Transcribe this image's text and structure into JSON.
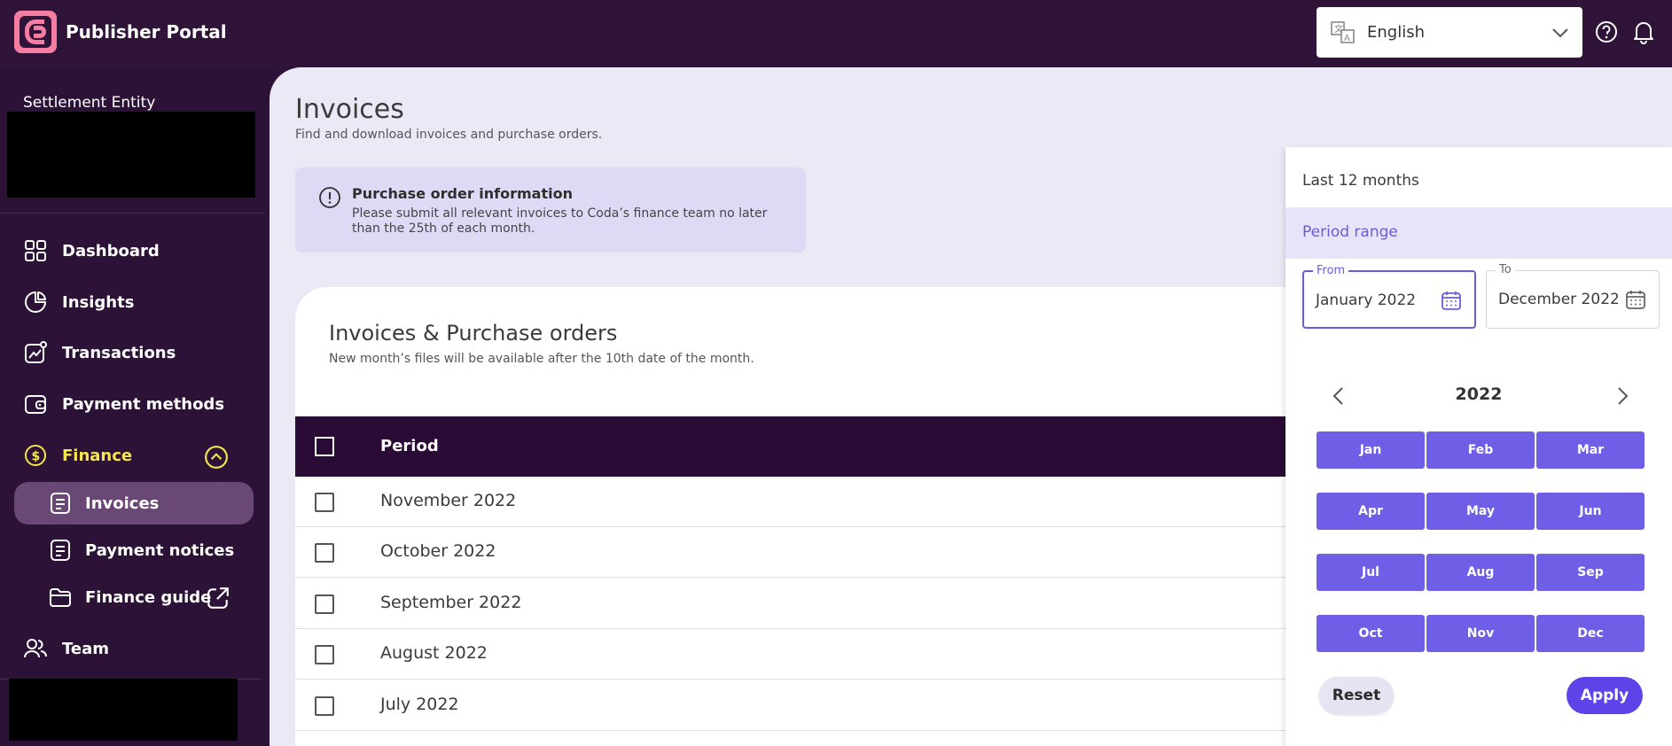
{
  "header": {
    "app_title": "Publisher Portal",
    "language": "English",
    "icons": [
      "translate-icon",
      "chevron-down-icon",
      "help-icon",
      "bell-icon"
    ]
  },
  "sidebar": {
    "entity_label": "Settlement Entity",
    "items": [
      {
        "label": "Dashboard",
        "icon": "grid-icon"
      },
      {
        "label": "Insights",
        "icon": "pie-chart-icon"
      },
      {
        "label": "Transactions",
        "icon": "trend-icon"
      },
      {
        "label": "Payment methods",
        "icon": "wallet-icon"
      },
      {
        "label": "Finance",
        "icon": "dollar-icon",
        "expanded": true
      },
      {
        "label": "Invoices",
        "icon": "document-icon",
        "active": true
      },
      {
        "label": "Payment notices",
        "icon": "document-icon"
      },
      {
        "label": "Finance guide",
        "icon": "folder-icon"
      },
      {
        "label": "Team",
        "icon": "team-icon"
      }
    ],
    "colors": {
      "finance": "#f4e64d",
      "active_bg": "#6a4876"
    }
  },
  "main": {
    "title": "Invoices",
    "subtitle": "Find and download invoices and purchase orders.",
    "info": {
      "title": "Purchase order information",
      "text": "Please submit all relevant invoices to Coda’s finance team no later than the 25th of each month."
    },
    "card": {
      "title": "Invoices & Purchase orders",
      "subtitle": "New month’s files will be available after the 10th date of the month.",
      "column_period": "Period",
      "rows": [
        "November 2022",
        "October 2022",
        "September 2022",
        "August 2022",
        "July 2022"
      ]
    }
  },
  "datepanel": {
    "option_last12": "Last 12 months",
    "option_range": "Period range",
    "from_label": "From",
    "from_value": "January 2022",
    "to_label": "To",
    "to_value": "December 2022",
    "year": "2022",
    "months": [
      "Jan",
      "Feb",
      "Mar",
      "Apr",
      "May",
      "Jun",
      "Jul",
      "Aug",
      "Sep",
      "Oct",
      "Nov",
      "Dec"
    ],
    "reset": "Reset",
    "apply": "Apply",
    "accent": "#6f5ee6"
  }
}
